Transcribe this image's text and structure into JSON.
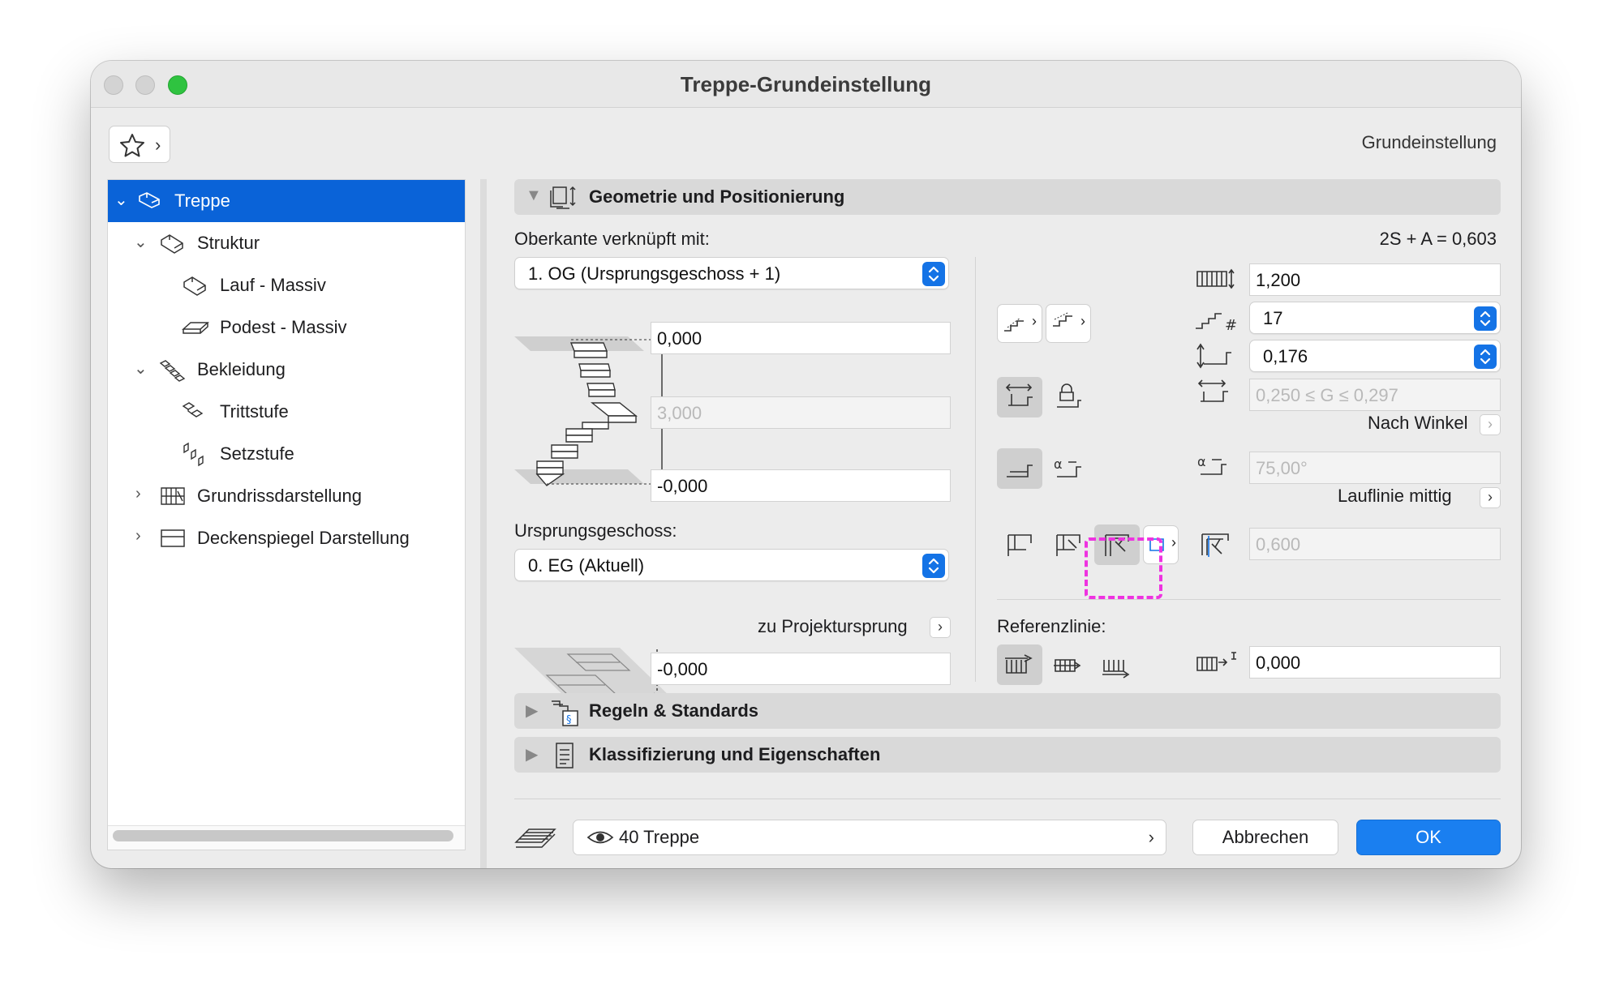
{
  "window": {
    "title": "Treppe-Grundeinstellung",
    "top_right_label": "Grundeinstellung"
  },
  "tree": {
    "items": [
      {
        "label": "Treppe"
      },
      {
        "label": "Struktur"
      },
      {
        "label": "Lauf - Massiv"
      },
      {
        "label": "Podest - Massiv"
      },
      {
        "label": "Bekleidung"
      },
      {
        "label": "Trittstufe"
      },
      {
        "label": "Setzstufe"
      },
      {
        "label": "Grundrissdarstellung"
      },
      {
        "label": "Deckenspiegel Darstellung"
      }
    ]
  },
  "geometry": {
    "header": "Geometrie und Positionierung",
    "top_linked_label": "Oberkante verknüpft mit:",
    "top_linked_value": "1. OG (Ursprungsgeschoss + 1)",
    "top_offset": "0,000",
    "height": "3,000",
    "bottom_offset": "-0,000",
    "home_story_label": "Ursprungsgeschoss:",
    "home_story_value": "0. EG (Aktuell)",
    "project_zero_label": "zu Projektursprung",
    "project_zero_value": "-0,000",
    "formula": "2S + A = 0,603",
    "width": "1,200",
    "risers": "17",
    "riser_height": "0,176",
    "going_range": "0,250 ≤ G ≤ 0,297",
    "by_angle_label": "Nach Winkel",
    "angle": "75,00°",
    "walkline_label": "Lauflinie mittig",
    "walkline_value": "0,600",
    "reference_label": "Referenzlinie:",
    "reference_offset": "0,000"
  },
  "sections": {
    "rules": "Regeln & Standards",
    "classification": "Klassifizierung und Eigenschaften"
  },
  "footer": {
    "layer": "40 Treppe",
    "cancel": "Abbrechen",
    "ok": "OK"
  },
  "colors": {
    "accent": "#0a63d8",
    "highlight": "#ee33e0",
    "ok": "#1a7ff0"
  }
}
